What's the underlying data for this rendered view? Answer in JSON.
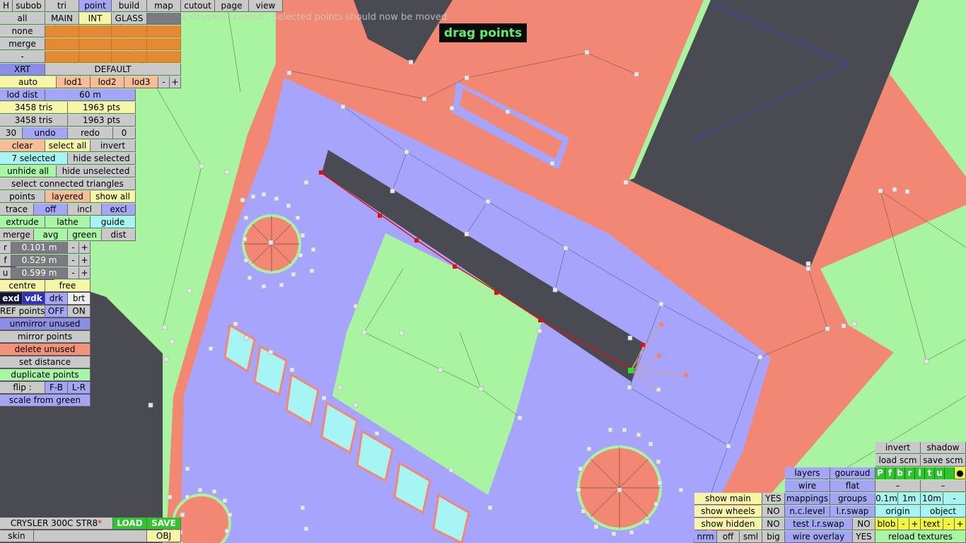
{
  "status_message": "Extrusion created - selected points should now be moved",
  "mode_label": "drag points",
  "top_tabs": [
    "H",
    "subob",
    "tri",
    "point",
    "build",
    "map",
    "cutout",
    "page",
    "view"
  ],
  "layer_row": [
    "all",
    "MAIN",
    "INT",
    "GLASS"
  ],
  "left_labels": {
    "none": "none",
    "merge": "merge",
    "dash": "-"
  },
  "xrt": {
    "label": "XRT",
    "value": "DEFAULT"
  },
  "lod": {
    "auto": "auto",
    "lod1": "lod1",
    "lod2": "lod2",
    "lod3": "lod3",
    "minus": "-",
    "plus": "+",
    "dist_label": "lod dist",
    "dist_value": "60 m"
  },
  "stats": {
    "tris1": "3458 tris",
    "pts1": "1963 pts",
    "tris2": "3458 tris",
    "pts2": "1963 pts"
  },
  "undo_row": {
    "count_left": "30",
    "undo": "undo",
    "redo": "redo",
    "count_right": "0"
  },
  "select_row": {
    "clear": "clear",
    "select_all": "select all",
    "invert": "invert"
  },
  "selected_row": {
    "selected": "7 selected",
    "hide_selected": "hide selected"
  },
  "unhide_row": {
    "unhide_all": "unhide all",
    "hide_unselected": "hide unselected"
  },
  "connected": "select connected triangles",
  "points_row": {
    "points": "points",
    "layered": "layered",
    "show_all": "show all"
  },
  "trace_row": {
    "trace": "trace",
    "off": "off",
    "incl": "incl",
    "excl": "excl"
  },
  "extrude_row": {
    "extrude": "extrude",
    "lathe": "lathe",
    "guide": "guide"
  },
  "merge_row": {
    "merge": "merge",
    "avg": "avg",
    "green": "green",
    "dist": "dist"
  },
  "params": [
    {
      "key": "r",
      "value": "0.101 m"
    },
    {
      "key": "f",
      "value": "0.529 m"
    },
    {
      "key": "u",
      "value": "0.599 m"
    }
  ],
  "stepper": {
    "minus": "-",
    "plus": "+"
  },
  "centre_row": {
    "centre": "centre",
    "free": "free"
  },
  "render_row": {
    "exd": "exd",
    "vdk": "vdk",
    "drk": "drk",
    "brt": "brt"
  },
  "ref_row": {
    "ref": "REF points",
    "off": "OFF",
    "on": "ON"
  },
  "actions": {
    "unmirror": "unmirror unused",
    "mirror": "mirror points",
    "delete": "delete unused",
    "set_distance": "set distance",
    "duplicate": "duplicate points"
  },
  "flip_row": {
    "flip": "flip :",
    "fb": "F-B",
    "lr": "L-R"
  },
  "scale_green": "scale from green",
  "bottom_left": {
    "model_name": "CRYSLER 300C STR8",
    "asterisk": "*",
    "load": "LOAD",
    "save": "SAVE",
    "skin": "skin",
    "obj": "OBJ"
  },
  "right_panel": {
    "invert": "invert",
    "shadow": "shadow",
    "load_scm": "load scm",
    "save_scm": "save scm",
    "layers": "layers",
    "gouraud": "gouraud",
    "wire": "wire",
    "flat": "flat",
    "mappings": "mappings",
    "groups": "groups",
    "nclevel": "n.c.level",
    "lrswap": "l.r.swap",
    "test_lrswap": "test l.r.swap",
    "test_no": "NO",
    "wire_overlay": "wire overlay",
    "wire_yes": "YES",
    "pfbrltu": [
      "P",
      "f",
      "b",
      "r",
      "l",
      "t",
      "u"
    ],
    "dot": "●",
    "dash1": "–",
    "dash2": "–",
    "steps": [
      "0.1m",
      "1m",
      "10m",
      "-"
    ],
    "origin": "origin",
    "object": "object",
    "blob": "blob",
    "text": "text",
    "reload": "reload textures",
    "show_main": "show main",
    "show_main_val": "YES",
    "show_wheels": "show wheels",
    "show_wheels_val": "NO",
    "show_hidden": "show hidden",
    "show_hidden_val": "NO",
    "nrm": "nrm",
    "off": "off",
    "sml": "sml",
    "big": "big"
  },
  "colors": {
    "body_red": "#f28874",
    "panel_blue": "#a6a4fd",
    "glass_green": "#a8f4a0",
    "window_dark": "#4a4b52",
    "lamp_cyan": "#a6f4f4",
    "selected_red": "#e01010",
    "active_green": "#31c42f"
  }
}
